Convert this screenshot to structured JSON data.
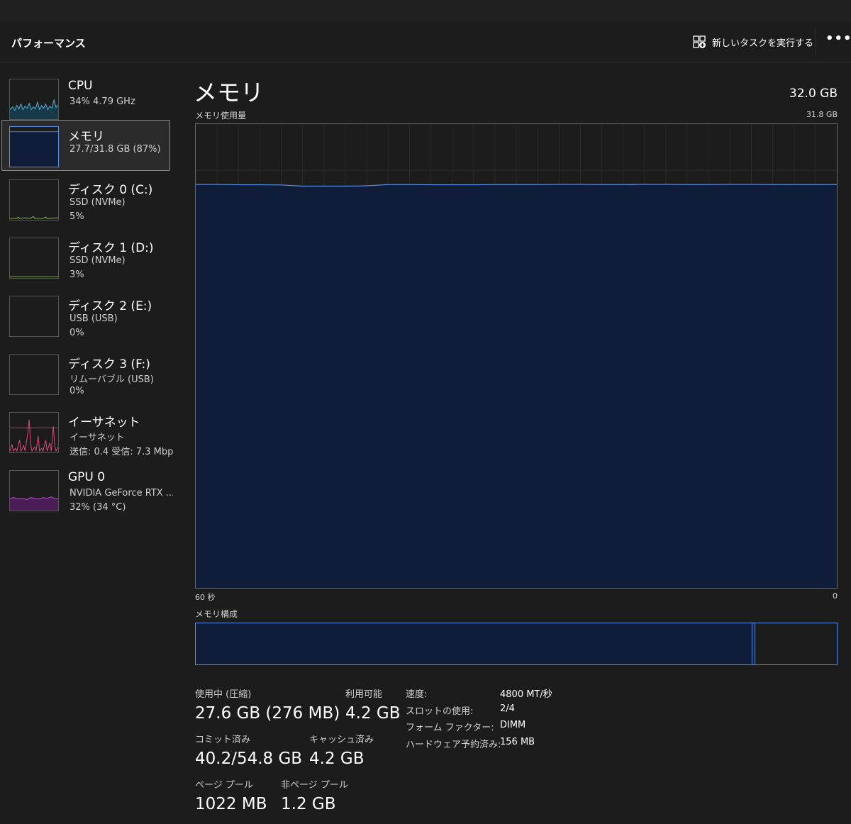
{
  "header": {
    "title": "パフォーマンス",
    "run_task_label": "新しいタスクを実行する",
    "more_label": "•••"
  },
  "devices": [
    {
      "name": "CPU",
      "line2": "34%  4.79 GHz",
      "line3": "",
      "graph_color": "#4fb3d9",
      "icon": "cpu-graph"
    },
    {
      "name": "メモリ",
      "line2": "27.7/31.8 GB (87%)",
      "line3": "",
      "graph_color": "#4a7fd4",
      "icon": "memory-graph"
    },
    {
      "name": "ディスク 0 (C:)",
      "line2": "SSD (NVMe)",
      "line3": "5%",
      "graph_color": "#7fbf3f",
      "icon": "disk-graph"
    },
    {
      "name": "ディスク 1 (D:)",
      "line2": "SSD (NVMe)",
      "line3": "3%",
      "graph_color": "#7fbf3f",
      "icon": "disk-graph"
    },
    {
      "name": "ディスク 2 (E:)",
      "line2": "USB (USB)",
      "line3": "0%",
      "graph_color": "#7fbf3f",
      "icon": "disk-graph"
    },
    {
      "name": "ディスク 3 (F:)",
      "line2": "リムーバブル (USB)",
      "line3": "0%",
      "graph_color": "#7fbf3f",
      "icon": "disk-graph"
    },
    {
      "name": "イーサネット",
      "line2": "イーサネット",
      "line3": "送信: 0.4  受信: 7.3 Mbps",
      "graph_color": "#e0487a",
      "icon": "ethernet-graph"
    },
    {
      "name": "GPU 0",
      "line2": "NVIDIA GeForce RTX ...",
      "line3": "32%  (34 °C)",
      "graph_color": "#b24fc4",
      "icon": "gpu-graph"
    }
  ],
  "main": {
    "heading": "メモリ",
    "total": "32.0 GB",
    "usage_label": "メモリ使用量",
    "max_label": "31.8 GB",
    "axis_left": "60 秒",
    "axis_right": "0",
    "composition_label": "メモリ構成",
    "usage_fraction": 0.87,
    "composition": {
      "in_use_fraction": 0.868,
      "standby_fraction": 0.132
    },
    "accent_color": "#5a8fe6",
    "fill_color": "#0f1d38"
  },
  "stats": [
    {
      "key": "使用中 (圧縮)",
      "value": "27.6 GB (276 MB)"
    },
    {
      "key": "利用可能",
      "value": "4.2 GB"
    },
    {
      "key": "コミット済み",
      "value": "40.2/54.8 GB"
    },
    {
      "key": "キャッシュ済み",
      "value": "4.2 GB"
    },
    {
      "key": "ページ プール",
      "value": "1022 MB"
    },
    {
      "key": "非ページ プール",
      "value": "1.2 GB"
    }
  ],
  "specs": [
    {
      "key": "速度:",
      "value": "4800 MT/秒"
    },
    {
      "key": "スロットの使用:",
      "value": "2/4"
    },
    {
      "key": "フォーム ファクター:",
      "value": "DIMM"
    },
    {
      "key": "ハードウェア予約済み:",
      "value": "156 MB"
    }
  ]
}
